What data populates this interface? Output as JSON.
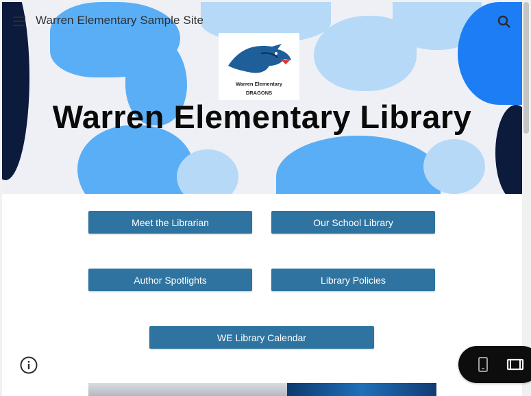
{
  "site": {
    "title": "Warren Elementary Sample Site",
    "menu_icon": "menu-icon",
    "search_icon": "search-icon"
  },
  "hero": {
    "logo_line1": "Warren Elementary",
    "logo_line2": "DRAGONS",
    "heading": "Warren Elementary Library"
  },
  "nav_buttons": [
    {
      "label": "Meet the Librarian"
    },
    {
      "label": "Our School Library"
    },
    {
      "label": "Author Spotlights"
    },
    {
      "label": "Library Policies"
    },
    {
      "label": "WE Library Calendar"
    }
  ],
  "footer": {
    "info_icon": "info-icon",
    "view_toggle": [
      "phone-icon",
      "desktop-icon"
    ]
  },
  "colors": {
    "button_bg": "#2f74a0",
    "hero_bg": "#eef0f6",
    "blob_light": "#b6d9f7",
    "blob_mid": "#5aaef5",
    "blob_dark": "#0c1a3c"
  }
}
